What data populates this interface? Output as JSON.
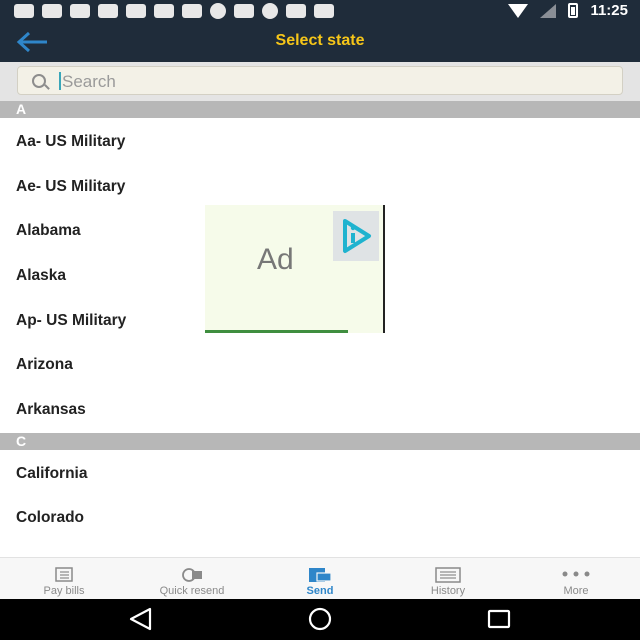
{
  "status_bar": {
    "time": "11:25",
    "icons": [
      "message-icon",
      "cat-icon",
      "link-icon",
      "cat-icon",
      "link-icon",
      "link-icon",
      "cat-icon",
      "b-icon",
      "mail-icon",
      "pinterest-icon",
      "cluster-icon",
      "e-icon"
    ]
  },
  "app_bar": {
    "title": "Select state",
    "back_icon": "back-arrow-icon",
    "title_color": "#f6c619",
    "background": "#1f2c3a"
  },
  "search": {
    "placeholder": "Search",
    "value": ""
  },
  "sections": [
    {
      "letter": "A",
      "items": [
        "Aa-  US Military",
        "Ae-  US Military",
        "Alabama",
        "Alaska",
        "Ap-  US Military",
        "Arizona",
        "Arkansas"
      ]
    },
    {
      "letter": "C",
      "items": [
        "California",
        "Colorado"
      ]
    }
  ],
  "ad": {
    "label": "Ad",
    "logo_icon": "ad-choices-icon"
  },
  "tabs": [
    {
      "label": "Pay bills",
      "icon": "bills-icon",
      "active": false
    },
    {
      "label": "Quick resend",
      "icon": "resend-icon",
      "active": false
    },
    {
      "label": "Send",
      "icon": "send-icon",
      "active": true
    },
    {
      "label": "History",
      "icon": "history-icon",
      "active": false
    },
    {
      "label": "More",
      "icon": "more-dots-icon",
      "active": false
    }
  ],
  "colors": {
    "accent": "#2f86c9",
    "section_header": "#b7b7b7"
  }
}
